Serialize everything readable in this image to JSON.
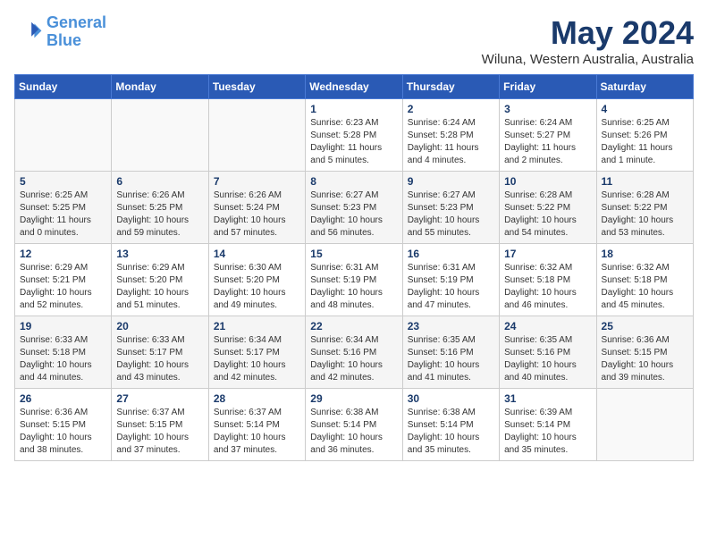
{
  "header": {
    "logo_line1": "General",
    "logo_line2": "Blue",
    "month": "May 2024",
    "location": "Wiluna, Western Australia, Australia"
  },
  "weekdays": [
    "Sunday",
    "Monday",
    "Tuesday",
    "Wednesday",
    "Thursday",
    "Friday",
    "Saturday"
  ],
  "weeks": [
    [
      {
        "day": "",
        "sunrise": "",
        "sunset": "",
        "daylight": ""
      },
      {
        "day": "",
        "sunrise": "",
        "sunset": "",
        "daylight": ""
      },
      {
        "day": "",
        "sunrise": "",
        "sunset": "",
        "daylight": ""
      },
      {
        "day": "1",
        "sunrise": "Sunrise: 6:23 AM",
        "sunset": "Sunset: 5:28 PM",
        "daylight": "Daylight: 11 hours and 5 minutes."
      },
      {
        "day": "2",
        "sunrise": "Sunrise: 6:24 AM",
        "sunset": "Sunset: 5:28 PM",
        "daylight": "Daylight: 11 hours and 4 minutes."
      },
      {
        "day": "3",
        "sunrise": "Sunrise: 6:24 AM",
        "sunset": "Sunset: 5:27 PM",
        "daylight": "Daylight: 11 hours and 2 minutes."
      },
      {
        "day": "4",
        "sunrise": "Sunrise: 6:25 AM",
        "sunset": "Sunset: 5:26 PM",
        "daylight": "Daylight: 11 hours and 1 minute."
      }
    ],
    [
      {
        "day": "5",
        "sunrise": "Sunrise: 6:25 AM",
        "sunset": "Sunset: 5:25 PM",
        "daylight": "Daylight: 11 hours and 0 minutes."
      },
      {
        "day": "6",
        "sunrise": "Sunrise: 6:26 AM",
        "sunset": "Sunset: 5:25 PM",
        "daylight": "Daylight: 10 hours and 59 minutes."
      },
      {
        "day": "7",
        "sunrise": "Sunrise: 6:26 AM",
        "sunset": "Sunset: 5:24 PM",
        "daylight": "Daylight: 10 hours and 57 minutes."
      },
      {
        "day": "8",
        "sunrise": "Sunrise: 6:27 AM",
        "sunset": "Sunset: 5:23 PM",
        "daylight": "Daylight: 10 hours and 56 minutes."
      },
      {
        "day": "9",
        "sunrise": "Sunrise: 6:27 AM",
        "sunset": "Sunset: 5:23 PM",
        "daylight": "Daylight: 10 hours and 55 minutes."
      },
      {
        "day": "10",
        "sunrise": "Sunrise: 6:28 AM",
        "sunset": "Sunset: 5:22 PM",
        "daylight": "Daylight: 10 hours and 54 minutes."
      },
      {
        "day": "11",
        "sunrise": "Sunrise: 6:28 AM",
        "sunset": "Sunset: 5:22 PM",
        "daylight": "Daylight: 10 hours and 53 minutes."
      }
    ],
    [
      {
        "day": "12",
        "sunrise": "Sunrise: 6:29 AM",
        "sunset": "Sunset: 5:21 PM",
        "daylight": "Daylight: 10 hours and 52 minutes."
      },
      {
        "day": "13",
        "sunrise": "Sunrise: 6:29 AM",
        "sunset": "Sunset: 5:20 PM",
        "daylight": "Daylight: 10 hours and 51 minutes."
      },
      {
        "day": "14",
        "sunrise": "Sunrise: 6:30 AM",
        "sunset": "Sunset: 5:20 PM",
        "daylight": "Daylight: 10 hours and 49 minutes."
      },
      {
        "day": "15",
        "sunrise": "Sunrise: 6:31 AM",
        "sunset": "Sunset: 5:19 PM",
        "daylight": "Daylight: 10 hours and 48 minutes."
      },
      {
        "day": "16",
        "sunrise": "Sunrise: 6:31 AM",
        "sunset": "Sunset: 5:19 PM",
        "daylight": "Daylight: 10 hours and 47 minutes."
      },
      {
        "day": "17",
        "sunrise": "Sunrise: 6:32 AM",
        "sunset": "Sunset: 5:18 PM",
        "daylight": "Daylight: 10 hours and 46 minutes."
      },
      {
        "day": "18",
        "sunrise": "Sunrise: 6:32 AM",
        "sunset": "Sunset: 5:18 PM",
        "daylight": "Daylight: 10 hours and 45 minutes."
      }
    ],
    [
      {
        "day": "19",
        "sunrise": "Sunrise: 6:33 AM",
        "sunset": "Sunset: 5:18 PM",
        "daylight": "Daylight: 10 hours and 44 minutes."
      },
      {
        "day": "20",
        "sunrise": "Sunrise: 6:33 AM",
        "sunset": "Sunset: 5:17 PM",
        "daylight": "Daylight: 10 hours and 43 minutes."
      },
      {
        "day": "21",
        "sunrise": "Sunrise: 6:34 AM",
        "sunset": "Sunset: 5:17 PM",
        "daylight": "Daylight: 10 hours and 42 minutes."
      },
      {
        "day": "22",
        "sunrise": "Sunrise: 6:34 AM",
        "sunset": "Sunset: 5:16 PM",
        "daylight": "Daylight: 10 hours and 42 minutes."
      },
      {
        "day": "23",
        "sunrise": "Sunrise: 6:35 AM",
        "sunset": "Sunset: 5:16 PM",
        "daylight": "Daylight: 10 hours and 41 minutes."
      },
      {
        "day": "24",
        "sunrise": "Sunrise: 6:35 AM",
        "sunset": "Sunset: 5:16 PM",
        "daylight": "Daylight: 10 hours and 40 minutes."
      },
      {
        "day": "25",
        "sunrise": "Sunrise: 6:36 AM",
        "sunset": "Sunset: 5:15 PM",
        "daylight": "Daylight: 10 hours and 39 minutes."
      }
    ],
    [
      {
        "day": "26",
        "sunrise": "Sunrise: 6:36 AM",
        "sunset": "Sunset: 5:15 PM",
        "daylight": "Daylight: 10 hours and 38 minutes."
      },
      {
        "day": "27",
        "sunrise": "Sunrise: 6:37 AM",
        "sunset": "Sunset: 5:15 PM",
        "daylight": "Daylight: 10 hours and 37 minutes."
      },
      {
        "day": "28",
        "sunrise": "Sunrise: 6:37 AM",
        "sunset": "Sunset: 5:14 PM",
        "daylight": "Daylight: 10 hours and 37 minutes."
      },
      {
        "day": "29",
        "sunrise": "Sunrise: 6:38 AM",
        "sunset": "Sunset: 5:14 PM",
        "daylight": "Daylight: 10 hours and 36 minutes."
      },
      {
        "day": "30",
        "sunrise": "Sunrise: 6:38 AM",
        "sunset": "Sunset: 5:14 PM",
        "daylight": "Daylight: 10 hours and 35 minutes."
      },
      {
        "day": "31",
        "sunrise": "Sunrise: 6:39 AM",
        "sunset": "Sunset: 5:14 PM",
        "daylight": "Daylight: 10 hours and 35 minutes."
      },
      {
        "day": "",
        "sunrise": "",
        "sunset": "",
        "daylight": ""
      }
    ]
  ]
}
